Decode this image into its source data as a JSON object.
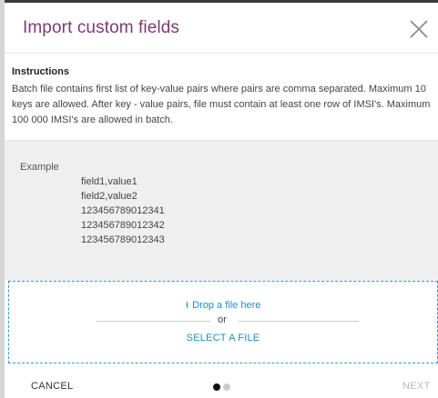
{
  "dialog": {
    "title": "Import custom fields",
    "close_icon": "close-icon"
  },
  "instructions": {
    "title": "Instructions",
    "text": "Batch file contains first list of key-value pairs where pairs are comma separated. Maximum 10 keys are allowed. After key - value pairs, file must contain at least one row of IMSI's. Maximum 100 000 IMSI's are allowed in batch."
  },
  "example": {
    "label": "Example",
    "lines": [
      "field1,value1",
      "field2,value2",
      "123456789012341",
      "123456789012342",
      "123456789012343"
    ]
  },
  "dropzone": {
    "upload_icon": "upload-icon",
    "upload_glyph": "⭱",
    "drop_label": "Drop a file here",
    "or_label": "or",
    "select_label": "SELECT A FILE"
  },
  "footer": {
    "cancel_label": "CANCEL",
    "next_label": "NEXT",
    "steps_total": 2,
    "current_step": 1
  },
  "colors": {
    "title": "#7a3b77",
    "accent": "#1a8fc0",
    "dropzone_border": "#2aa0c6",
    "example_bg": "#efefef"
  }
}
